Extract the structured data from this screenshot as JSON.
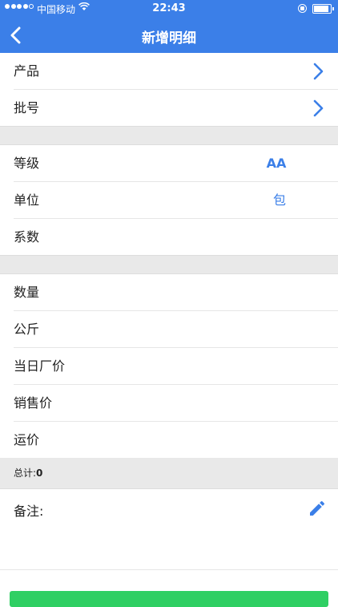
{
  "status_bar": {
    "carrier": "中国移动",
    "time": "22:43"
  },
  "nav": {
    "title": "新增明细"
  },
  "rows_group1": [
    {
      "label": "产品"
    },
    {
      "label": "批号"
    }
  ],
  "rows_group2": {
    "grade": {
      "label": "等级",
      "value": "AA"
    },
    "unit": {
      "label": "单位",
      "value": "包"
    },
    "coefficient": {
      "label": "系数"
    }
  },
  "rows_group3": [
    {
      "label": "数量"
    },
    {
      "label": "公斤"
    },
    {
      "label": "当日厂价"
    },
    {
      "label": "销售价"
    },
    {
      "label": "运价"
    }
  ],
  "total": {
    "label": "总计:",
    "value": "0"
  },
  "remark": {
    "label": "备注:"
  },
  "colors": {
    "primary": "#3b7fe8",
    "save_button": "#2fcf63",
    "section_gap": "#e9e9e9"
  },
  "icons": [
    "chevron-left-icon",
    "chevron-right-icon",
    "pencil-icon",
    "wifi-icon",
    "lock-rotation-icon",
    "battery-icon"
  ]
}
